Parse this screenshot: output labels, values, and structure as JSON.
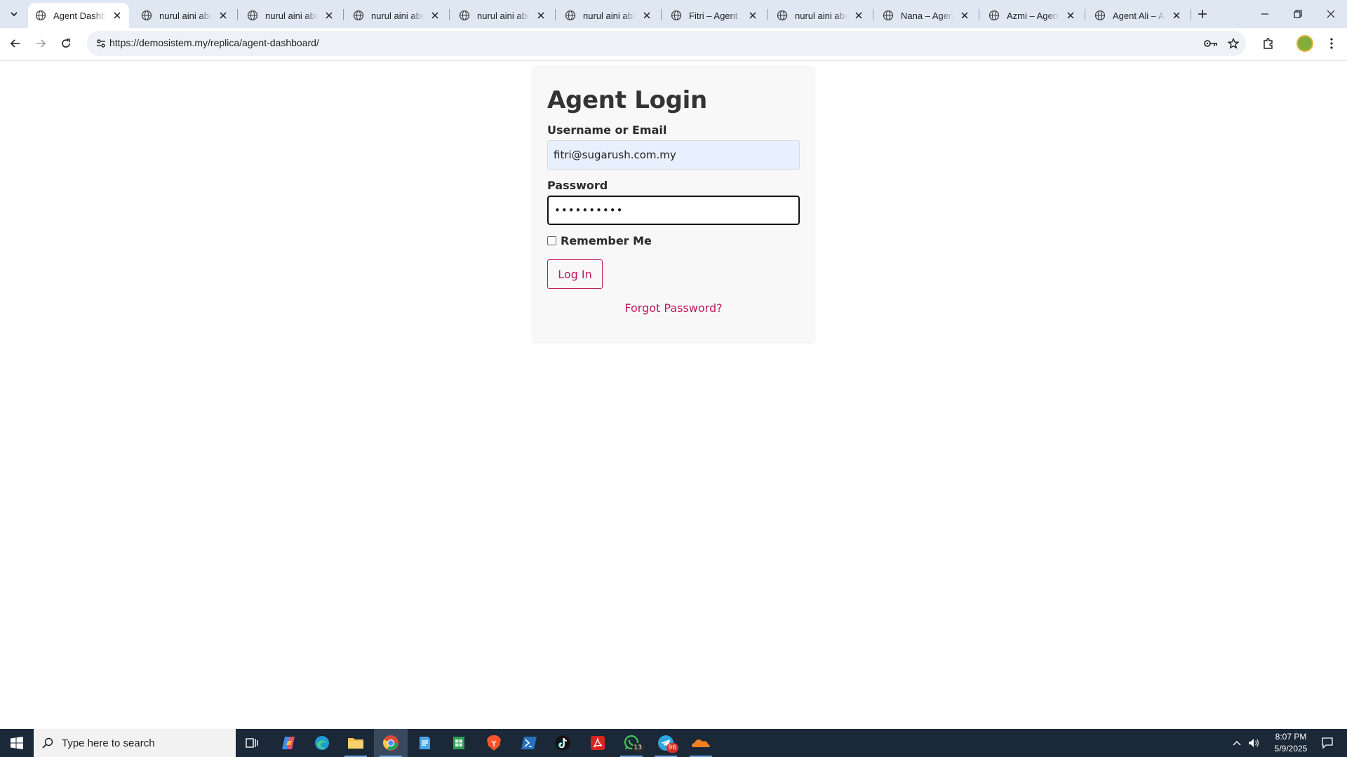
{
  "browser": {
    "tabs": [
      {
        "title": "Agent Dashboard",
        "active": true
      },
      {
        "title": "nurul aini abdul",
        "active": false
      },
      {
        "title": "nurul aini abdul",
        "active": false
      },
      {
        "title": "nurul aini abdul",
        "active": false
      },
      {
        "title": "nurul aini abdul",
        "active": false
      },
      {
        "title": "nurul aini abdul",
        "active": false
      },
      {
        "title": "Fitri – Agent Page",
        "active": false
      },
      {
        "title": "nurul aini abdul",
        "active": false
      },
      {
        "title": "Nana – Agent Page",
        "active": false
      },
      {
        "title": "Azmi – Agent Page",
        "active": false
      },
      {
        "title": "Agent Ali – Agent",
        "active": false
      }
    ],
    "url": "https://demosistem.my/replica/agent-dashboard/"
  },
  "login": {
    "title": "Agent Login",
    "username_label": "Username or Email",
    "username_value": "fitri@sugarush.com.my",
    "password_label": "Password",
    "password_value": "••••••••••",
    "remember_label": "Remember Me",
    "remember_checked": false,
    "login_button": "Log In",
    "forgot_link": "Forgot Password?"
  },
  "colors": {
    "accent": "#c2185b",
    "autofill_bg": "#e8f0fe",
    "card_bg": "#f8f8f8",
    "taskbar_bg": "#1b2838"
  },
  "taskbar": {
    "search_placeholder": "Type here to search",
    "apps": [
      {
        "icon": "task-view-icon"
      },
      {
        "icon": "copilot-icon"
      },
      {
        "icon": "edge-icon"
      },
      {
        "icon": "file-explorer-icon"
      },
      {
        "icon": "chrome-icon",
        "active": true
      },
      {
        "icon": "notepad-icon"
      },
      {
        "icon": "spreadsheet-icon"
      },
      {
        "icon": "brave-icon"
      },
      {
        "icon": "powershell-icon"
      },
      {
        "icon": "tiktok-icon"
      },
      {
        "icon": "acrobat-icon"
      },
      {
        "icon": "whatsapp-icon",
        "badge": "13"
      },
      {
        "icon": "telegram-icon",
        "badge": "96"
      },
      {
        "icon": "cloudflare-icon"
      }
    ],
    "time": "8:07 PM",
    "date": "5/9/2025"
  }
}
